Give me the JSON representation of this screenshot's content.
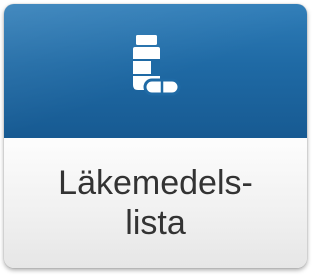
{
  "tile": {
    "label_line1": "Läkemedels-",
    "label_line2": "lista",
    "icon": "medicine-bottle-icon",
    "colors": {
      "top_background": "#1f6aa5",
      "bottom_background": "#f0f0f0",
      "icon": "#ffffff",
      "label": "#333333"
    }
  }
}
